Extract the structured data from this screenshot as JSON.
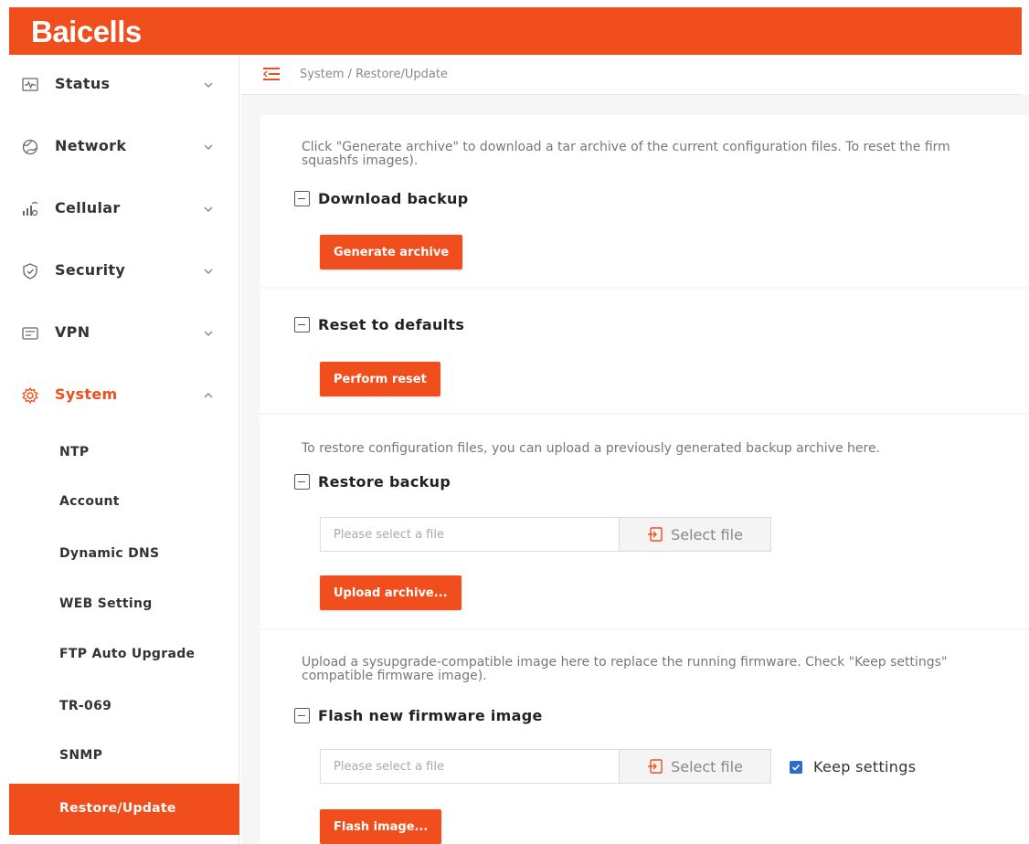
{
  "brand": {
    "logo_text": "Baicells",
    "accent_color": "#f04e1d"
  },
  "sidebar": {
    "items": [
      {
        "label": "Status",
        "icon": "monitor-wave-icon",
        "expanded": false
      },
      {
        "label": "Network",
        "icon": "globe-icon",
        "expanded": false
      },
      {
        "label": "Cellular",
        "icon": "signal-bars-icon",
        "expanded": false
      },
      {
        "label": "Security",
        "icon": "shield-check-icon",
        "expanded": false
      },
      {
        "label": "VPN",
        "icon": "vpn-box-icon",
        "expanded": false
      },
      {
        "label": "System",
        "icon": "gear-icon",
        "expanded": true
      }
    ],
    "system_subitems": [
      {
        "label": "NTP"
      },
      {
        "label": "Account"
      },
      {
        "label": "Dynamic DNS"
      },
      {
        "label": "WEB Setting"
      },
      {
        "label": "FTP Auto Upgrade"
      },
      {
        "label": "TR-069"
      },
      {
        "label": "SNMP"
      },
      {
        "label": "Restore/Update",
        "selected": true
      }
    ]
  },
  "breadcrumb": {
    "text": "System / Restore/Update"
  },
  "sections": {
    "download": {
      "description_line1": "Click \"Generate archive\" to download a tar archive of the current configuration files. To reset the firm",
      "description_line2": "squashfs images).",
      "title": "Download backup",
      "button": "Generate archive"
    },
    "reset": {
      "title": "Reset to defaults",
      "button": "Perform reset"
    },
    "restore": {
      "description": "To restore configuration files, you can upload a previously generated backup archive here.",
      "title": "Restore backup",
      "file_placeholder": "Please select a file",
      "select_label": "Select file",
      "button": "Upload archive..."
    },
    "flash": {
      "description_line1": "Upload a sysupgrade-compatible image here to replace the running firmware. Check \"Keep settings\"",
      "description_line2": "compatible firmware image).",
      "title": "Flash new firmware image",
      "file_placeholder": "Please select a file",
      "select_label": "Select file",
      "keep_settings_label": "Keep settings",
      "keep_settings_checked": true,
      "button": "Flash image..."
    }
  }
}
